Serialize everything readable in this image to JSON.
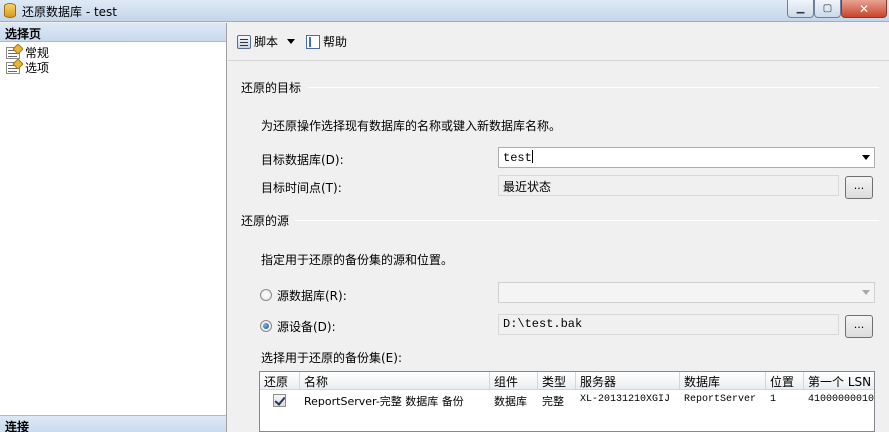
{
  "window": {
    "title": "还原数据库 - test",
    "min_glyph": "▁",
    "max_glyph": "▢",
    "close_glyph": "✕"
  },
  "left_panel": {
    "header": "选择页",
    "items": [
      {
        "label": "常规",
        "icon": "page-icon"
      },
      {
        "label": "选项",
        "icon": "page-icon"
      }
    ],
    "footer": "连接"
  },
  "toolbar": {
    "script_label": "脚本",
    "help_label": "帮助"
  },
  "destination": {
    "section_title": "还原的目标",
    "description": "为还原操作选择现有数据库的名称或键入新数据库名称。",
    "target_db_label": "目标数据库(D):",
    "target_db_value": "test",
    "target_time_label": "目标时间点(T):",
    "target_time_value": "最近状态",
    "browse_label": "..."
  },
  "source": {
    "section_title": "还原的源",
    "description": "指定用于还原的备份集的源和位置。",
    "from_db_label": "源数据库(R):",
    "from_db_value": "",
    "from_device_label": "源设备(D):",
    "from_device_value": "D:\\test.bak",
    "browse_label": "...",
    "selected": "device"
  },
  "backup_sets": {
    "label": "选择用于还原的备份集(E):",
    "columns": [
      "还原",
      "名称",
      "组件",
      "类型",
      "服务器",
      "数据库",
      "位置",
      "第一个 LSN"
    ],
    "rows": [
      {
        "restore": true,
        "name": "ReportServer-完整 数据库 备份",
        "component": "数据库",
        "type": "完整",
        "server": "XL-20131210XGIJ",
        "database": "ReportServer",
        "position": "1",
        "first_lsn": "41000000010"
      }
    ]
  }
}
